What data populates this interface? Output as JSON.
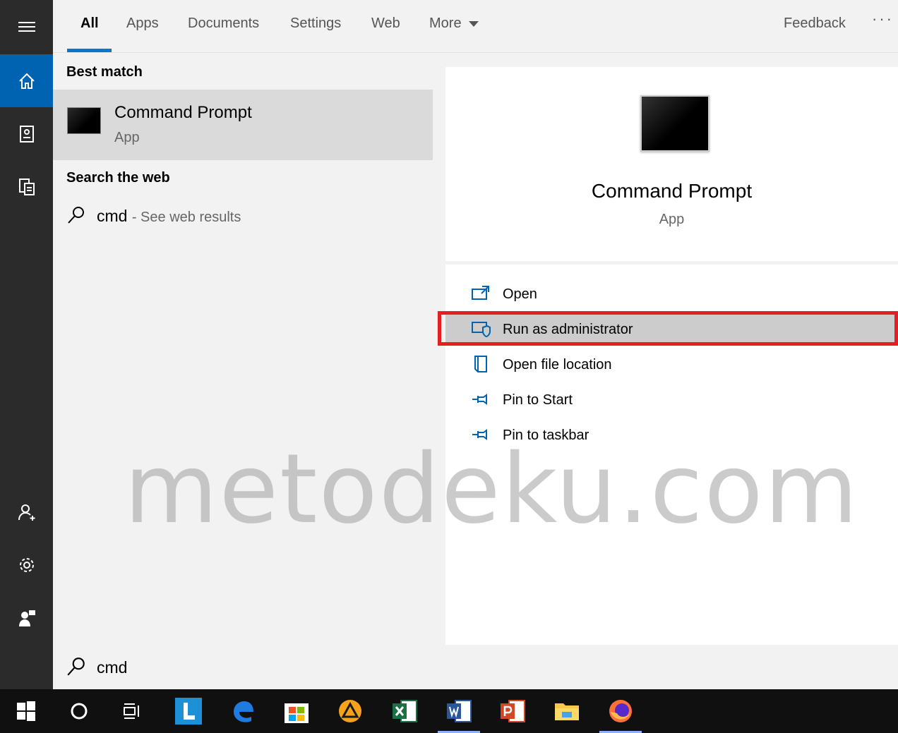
{
  "tabs": [
    {
      "label": "All",
      "active": true
    },
    {
      "label": "Apps"
    },
    {
      "label": "Documents"
    },
    {
      "label": "Settings"
    },
    {
      "label": "Web"
    },
    {
      "label": "More"
    }
  ],
  "feedback_label": "Feedback",
  "ellipsis": "···",
  "results": {
    "best_match_title": "Best match",
    "best_item": {
      "title": "Command Prompt",
      "subtitle": "App"
    },
    "search_web_title": "Search the web",
    "web_query": "cmd",
    "web_hint": "- See web results"
  },
  "detail": {
    "title": "Command Prompt",
    "subtitle": "App",
    "actions": [
      {
        "label": "Open",
        "icon": "open-window-icon"
      },
      {
        "label": "Run as administrator",
        "icon": "shield-window-icon",
        "highlighted": true
      },
      {
        "label": "Open file location",
        "icon": "file-location-icon"
      },
      {
        "label": "Pin to Start",
        "icon": "pin-icon"
      },
      {
        "label": "Pin to taskbar",
        "icon": "pin-icon"
      }
    ]
  },
  "search": {
    "value": "cmd"
  },
  "watermark": "metodeku.com",
  "colors": {
    "accent": "#0078d7",
    "rail": "#2b2b2b",
    "taskbar": "#101010",
    "highlight_box": "#e31e24"
  }
}
